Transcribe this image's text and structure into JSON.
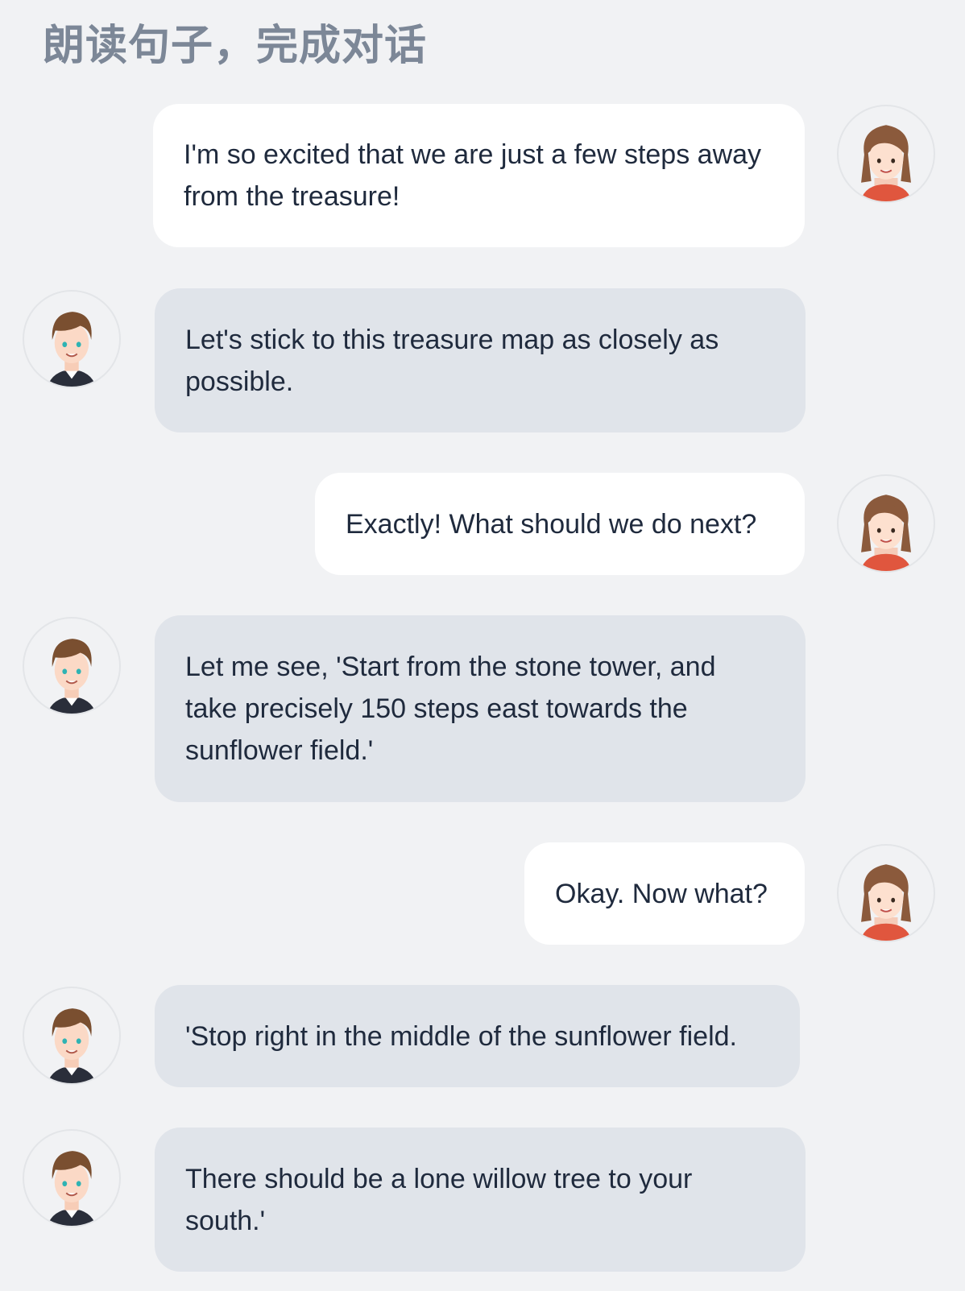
{
  "header": {
    "title": "朗读句子，完成对话"
  },
  "messages": [
    {
      "speaker": "girl",
      "text": "I'm so excited that we are just a few steps away from the treasure!"
    },
    {
      "speaker": "boy",
      "text": "Let's stick to this treasure map as closely as possible."
    },
    {
      "speaker": "girl",
      "text": "Exactly! What should we do next?"
    },
    {
      "speaker": "boy",
      "text": "Let me see, 'Start from the stone tower, and take precisely 150 steps east towards the sunflower field.'"
    },
    {
      "speaker": "girl",
      "text": "Okay. Now what?"
    },
    {
      "speaker": "boy",
      "text": "'Stop right in the middle of the sunflower field."
    },
    {
      "speaker": "boy",
      "text": "There should be a lone willow tree to your south.'"
    }
  ],
  "avatars": {
    "girl": "girl-avatar-icon",
    "boy": "boy-avatar-icon"
  }
}
